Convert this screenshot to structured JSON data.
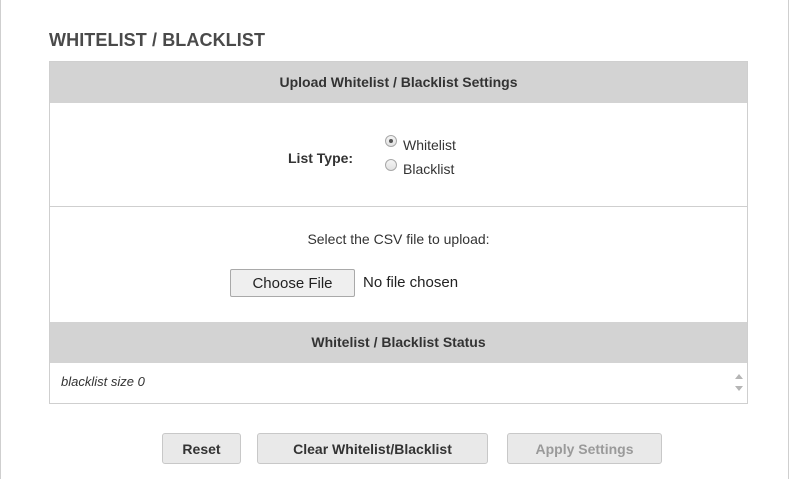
{
  "page": {
    "title": "WHITELIST / BLACKLIST"
  },
  "upload_section": {
    "header": "Upload Whitelist / Blacklist Settings",
    "list_type_label": "List Type:",
    "options": [
      {
        "label": "Whitelist",
        "selected": true
      },
      {
        "label": "Blacklist",
        "selected": false
      }
    ],
    "csv_prompt": "Select the CSV file to upload:",
    "file_button_label": "Choose File",
    "file_status": "No file chosen"
  },
  "status_section": {
    "header": "Whitelist / Blacklist Status",
    "value": "blacklist size 0"
  },
  "actions": {
    "reset": "Reset",
    "clear": "Clear Whitelist/Blacklist",
    "apply": "Apply Settings"
  }
}
